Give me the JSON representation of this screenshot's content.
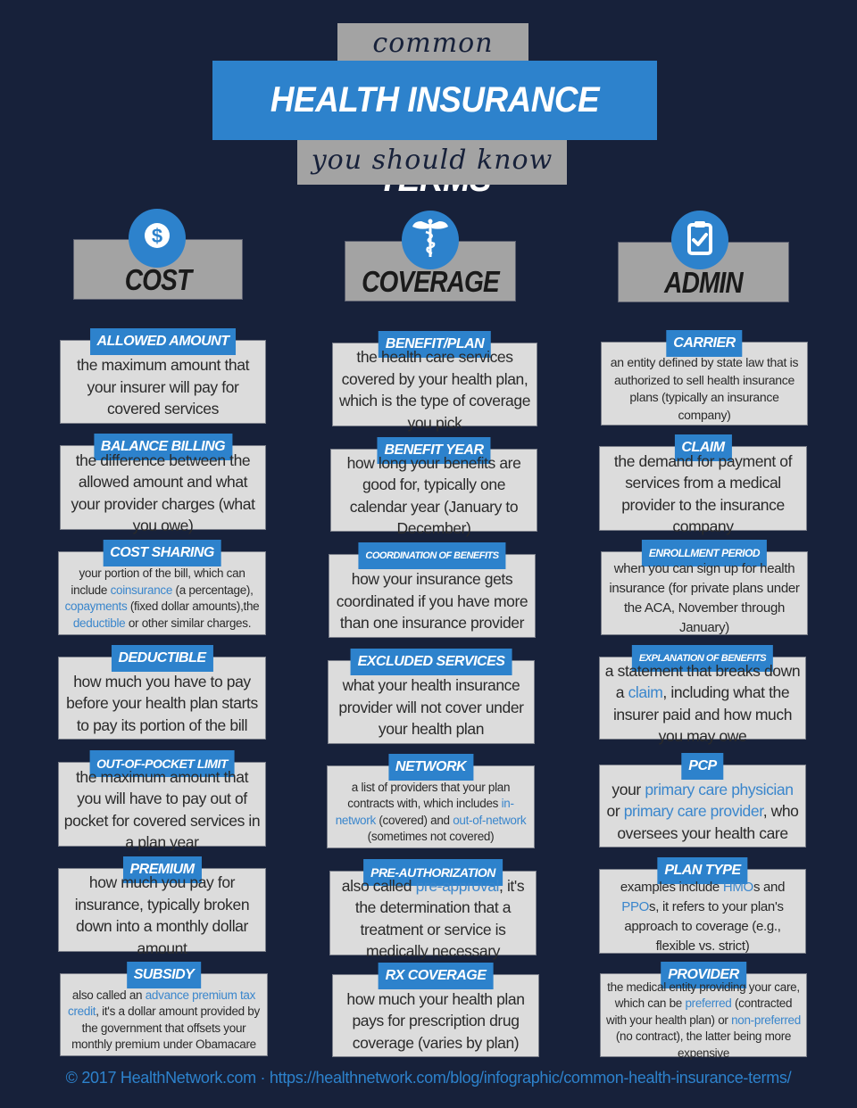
{
  "header": {
    "pre_title": "common",
    "title": "HEALTH INSURANCE TERMS",
    "subtitle": "you should know"
  },
  "colors": {
    "background": "#17213a",
    "accent_blue": "#2d82cc",
    "box_gray": "#dcdcdc",
    "header_gray": "#a3a3a3",
    "link_blue": "#3a86cc"
  },
  "categories": [
    {
      "label": "COST",
      "icon": "dollar-icon",
      "terms": [
        {
          "title": "ALLOWED AMOUNT",
          "desc": [
            {
              "t": "the maximum amount that your insurer will pay for covered services"
            }
          ]
        },
        {
          "title": "BALANCE BILLING",
          "desc": [
            {
              "t": "the difference between the allowed amount and what your provider charges (what you owe)"
            }
          ]
        },
        {
          "title": "COST SHARING",
          "desc": [
            {
              "t": "your portion of the bill, which can include "
            },
            {
              "t": "coinsurance",
              "hl": true
            },
            {
              "t": " (a percentage), "
            },
            {
              "t": "copayments",
              "hl": true
            },
            {
              "t": " (fixed dollar amounts),the "
            },
            {
              "t": "deductible",
              "hl": true
            },
            {
              "t": " or other similar charges."
            }
          ]
        },
        {
          "title": "DEDUCTIBLE",
          "desc": [
            {
              "t": "how much you have to pay before your health plan starts to pay its portion of the bill"
            }
          ]
        },
        {
          "title": "OUT-OF-POCKET LIMIT",
          "desc": [
            {
              "t": "the maximum amount that you will have to pay out of pocket for covered services in a plan year"
            }
          ]
        },
        {
          "title": "PREMIUM",
          "desc": [
            {
              "t": "how much you pay for insurance, typically broken down into a monthly dollar amount"
            }
          ]
        },
        {
          "title": "SUBSIDY",
          "desc": [
            {
              "t": "also called an "
            },
            {
              "t": "advance premium tax credit",
              "hl": true
            },
            {
              "t": ", it's a dollar amount provided by the government that offsets your monthly premium under Obamacare"
            }
          ]
        }
      ]
    },
    {
      "label": "COVERAGE",
      "icon": "caduceus-icon",
      "terms": [
        {
          "title": "BENEFIT/PLAN",
          "desc": [
            {
              "t": "the health care services covered by your health plan, which is the type of coverage you pick"
            }
          ]
        },
        {
          "title": "BENEFIT YEAR",
          "desc": [
            {
              "t": "how long your benefits are good for, typically one calendar year (January to December)"
            }
          ]
        },
        {
          "title": "COORDINATION OF BENEFITS",
          "desc": [
            {
              "t": "how your insurance gets coordinated if you have more than one insurance provider"
            }
          ]
        },
        {
          "title": "EXCLUDED SERVICES",
          "desc": [
            {
              "t": "what your health insurance provider will not cover under your health plan"
            }
          ]
        },
        {
          "title": "NETWORK",
          "desc": [
            {
              "t": "a list of providers that your plan contracts with, which includes "
            },
            {
              "t": "in-network",
              "hl": true
            },
            {
              "t": " (covered) and "
            },
            {
              "t": "out-of-network",
              "hl": true
            },
            {
              "t": " (sometimes not covered)"
            }
          ]
        },
        {
          "title": "PRE-AUTHORIZATION",
          "desc": [
            {
              "t": "also called "
            },
            {
              "t": "pre-approval",
              "hl": true
            },
            {
              "t": ", it's the determination that a treatment or service is medically necessary"
            }
          ]
        },
        {
          "title": "RX COVERAGE",
          "desc": [
            {
              "t": "how much your health plan pays for prescription drug coverage (varies by plan)"
            }
          ]
        }
      ]
    },
    {
      "label": "ADMIN",
      "icon": "clipboard-check-icon",
      "terms": [
        {
          "title": "CARRIER",
          "desc": [
            {
              "t": "an entity defined by state law that is authorized to sell health insurance plans (typically an insurance company)"
            }
          ]
        },
        {
          "title": "CLAIM",
          "desc": [
            {
              "t": "the demand for payment of services from a medical provider to the insurance company"
            }
          ]
        },
        {
          "title": "ENROLLMENT PERIOD",
          "desc": [
            {
              "t": "when you can sign up for health insurance (for private plans under the ACA, November through January)"
            }
          ]
        },
        {
          "title": "EXPLANATION OF BENEFITS",
          "desc": [
            {
              "t": "a statement that breaks down a "
            },
            {
              "t": "claim",
              "hl": true
            },
            {
              "t": ", including what the insurer paid and how much you may owe"
            }
          ]
        },
        {
          "title": "PCP",
          "desc": [
            {
              "t": "your "
            },
            {
              "t": "primary care physician",
              "hl": true
            },
            {
              "t": " or "
            },
            {
              "t": "primary care provider",
              "hl": true
            },
            {
              "t": ", who oversees your health care"
            }
          ]
        },
        {
          "title": "PLAN TYPE",
          "desc": [
            {
              "t": "examples include "
            },
            {
              "t": "HMO",
              "hl": true
            },
            {
              "t": "s and "
            },
            {
              "t": "PPO",
              "hl": true
            },
            {
              "t": "s, it refers to your plan's approach to coverage (e.g., flexible vs. strict)"
            }
          ]
        },
        {
          "title": "PROVIDER",
          "desc": [
            {
              "t": "the medical entity providing your care, which can be "
            },
            {
              "t": "preferred",
              "hl": true
            },
            {
              "t": " (contracted with your health plan) or "
            },
            {
              "t": "non-preferred",
              "hl": true
            },
            {
              "t": " (no contract), the latter being more expensive"
            }
          ]
        }
      ]
    }
  ],
  "footer": {
    "text": "© 2017 HealthNetwork.com · https://healthnetwork.com/blog/infographic/common-health-insurance-terms/"
  }
}
